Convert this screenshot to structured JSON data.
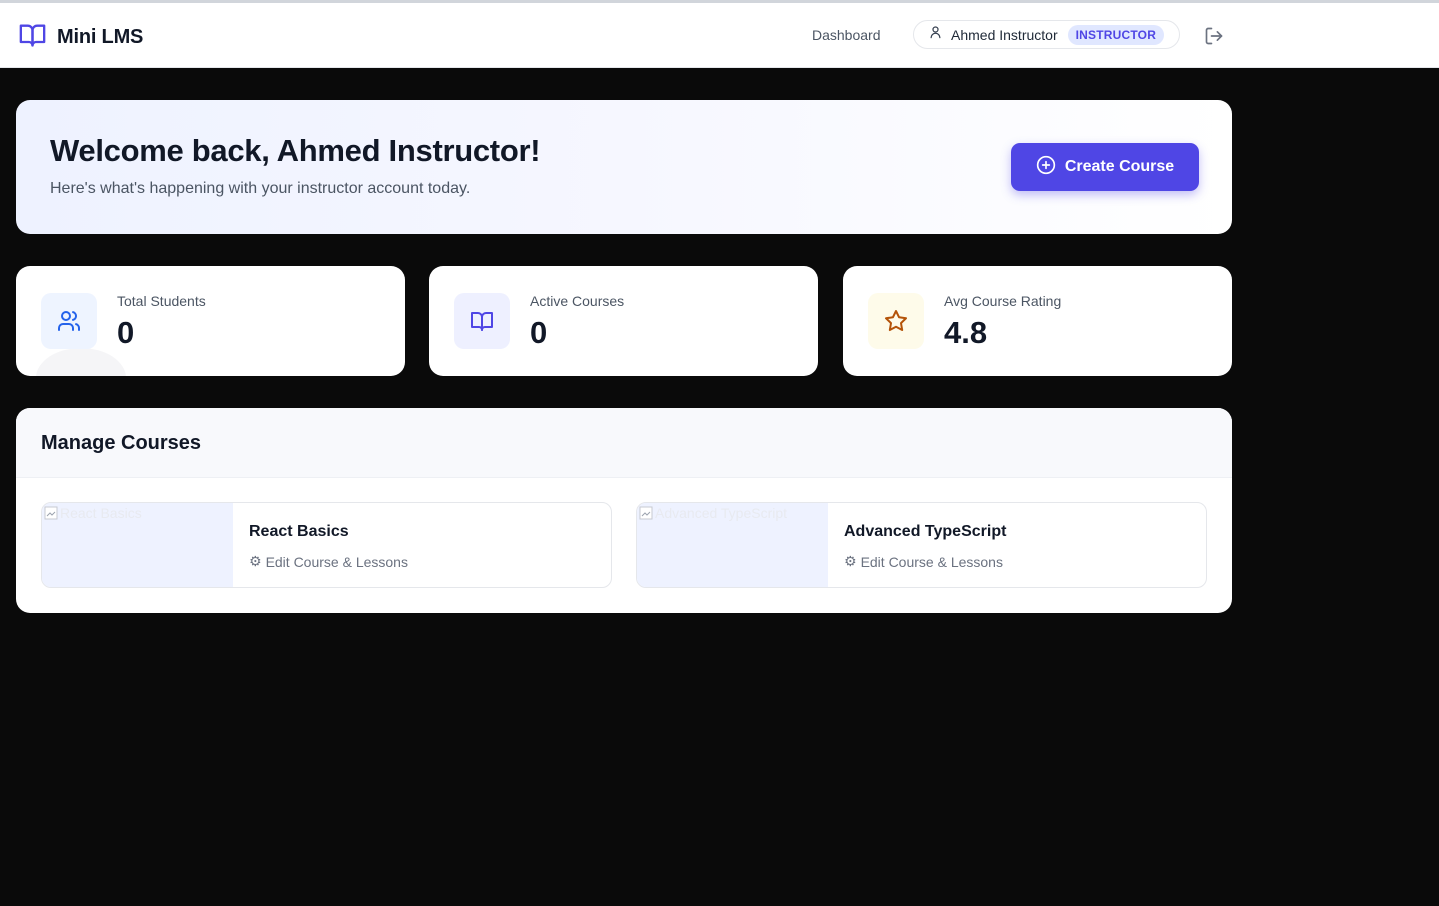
{
  "app": {
    "brand": "Mini LMS",
    "accent_color": "#4f46e5"
  },
  "nav": {
    "dashboard_label": "Dashboard",
    "user_name": "Ahmed Instructor",
    "role_badge": "INSTRUCTOR",
    "logout_icon": "logout-icon"
  },
  "welcome": {
    "title": "Welcome back, Ahmed Instructor!",
    "subtitle": "Here's what's happening with your instructor account today.",
    "create_button_label": "Create Course"
  },
  "stats": [
    {
      "label": "Total Students",
      "value": "0",
      "icon": "users-icon",
      "icon_color": "#2563eb",
      "icon_bg": "#eef4ff"
    },
    {
      "label": "Active Courses",
      "value": "0",
      "icon": "book-icon",
      "icon_color": "#4f46e5",
      "icon_bg": "#eef0ff"
    },
    {
      "label": "Avg Course Rating",
      "value": "4.8",
      "icon": "star-icon",
      "icon_color": "#b45309",
      "icon_bg": "#fefbea"
    }
  ],
  "manage": {
    "heading": "Manage Courses",
    "courses": [
      {
        "title": "React Basics",
        "thumb_alt": "React Basics",
        "edit_label": "Edit Course & Lessons"
      },
      {
        "title": "Advanced TypeScript",
        "thumb_alt": "Advanced TypeScript",
        "edit_label": "Edit Course & Lessons"
      }
    ]
  }
}
